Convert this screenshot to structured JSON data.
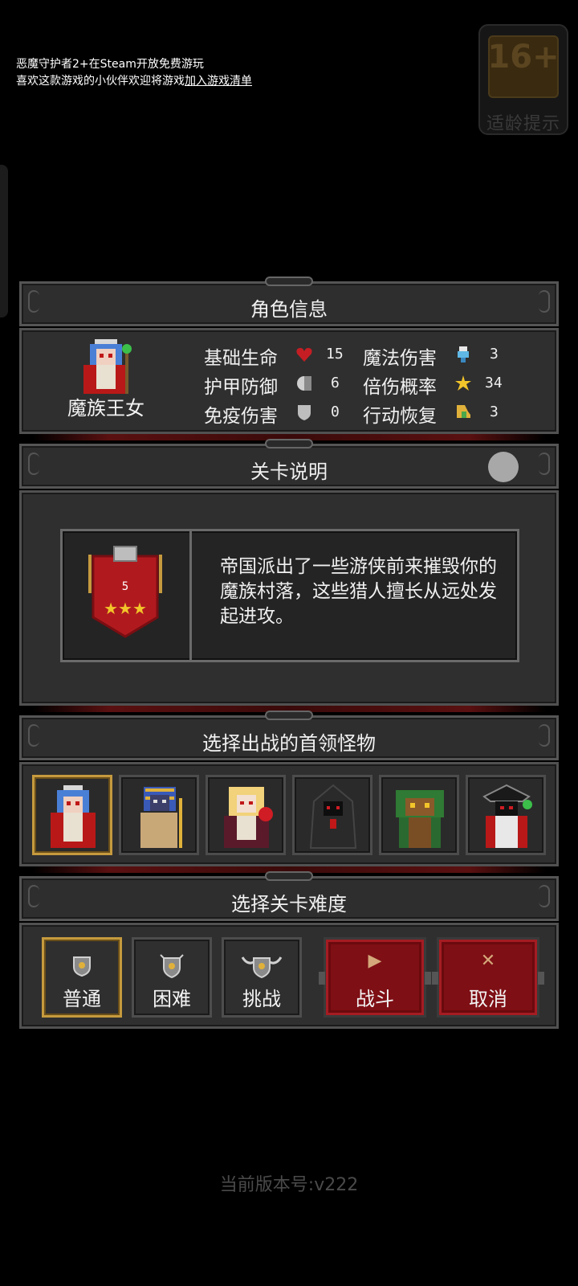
{
  "promo": {
    "line1": "恶魔守护者2+在Steam开放免费游玩",
    "line2_prefix": "喜欢这款游戏的小伙伴欢迎将游戏",
    "line2_link": "加入游戏清单"
  },
  "age_badge": {
    "rating": "16+",
    "label": "适龄提示"
  },
  "character_panel": {
    "title": "角色信息",
    "character_name": "魔族王女",
    "stats": [
      {
        "label": "基础生命",
        "icon": "heart-icon",
        "value": "15"
      },
      {
        "label": "护甲防御",
        "icon": "armor-icon",
        "value": "6"
      },
      {
        "label": "免疫伤害",
        "icon": "shield-icon",
        "value": "0"
      },
      {
        "label": "魔法伤害",
        "icon": "magic-potion-icon",
        "value": "3"
      },
      {
        "label": "倍伤概率",
        "icon": "crit-star-icon",
        "value": "34"
      },
      {
        "label": "行动恢复",
        "icon": "boot-icon",
        "value": "3"
      }
    ]
  },
  "stage_panel": {
    "title": "关卡说明",
    "level": "5",
    "stars": 3,
    "description": "帝国派出了一些游侠前来摧毁你的魔族村落，这些猎人擅长从远处发起进攻。"
  },
  "boss_panel": {
    "title": "选择出战的首领怪物",
    "bosses": [
      "demon-princess",
      "pharaoh-mummy",
      "vampire-girl",
      "hooded-reaper",
      "forest-treant",
      "dark-lich"
    ],
    "selected_index": 0
  },
  "difficulty_panel": {
    "title": "选择关卡难度",
    "options": [
      "普通",
      "困难",
      "挑战"
    ],
    "selected_index": 0,
    "fight_label": "战斗",
    "cancel_label": "取消"
  },
  "version_text": "当前版本号:v222",
  "colors": {
    "gold": "#c59a3e",
    "crimson": "#7e0f15",
    "panel": "#2f2f2f"
  }
}
